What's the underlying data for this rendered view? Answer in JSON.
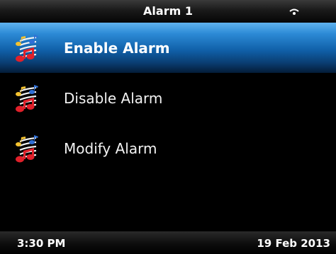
{
  "header": {
    "title": "Alarm 1",
    "signal_icon": "wifi-signal-icon"
  },
  "menu": {
    "items": [
      {
        "label": "Enable Alarm",
        "icon": "music-notes-icon",
        "selected": true
      },
      {
        "label": "Disable Alarm",
        "icon": "music-notes-icon",
        "selected": false
      },
      {
        "label": "Modify Alarm",
        "icon": "music-notes-icon",
        "selected": false
      }
    ]
  },
  "status": {
    "time": "3:30 PM",
    "date": "19 Feb 2013"
  },
  "colors": {
    "selection": "#1060a8",
    "background": "#000000",
    "text": "#ffffff"
  }
}
